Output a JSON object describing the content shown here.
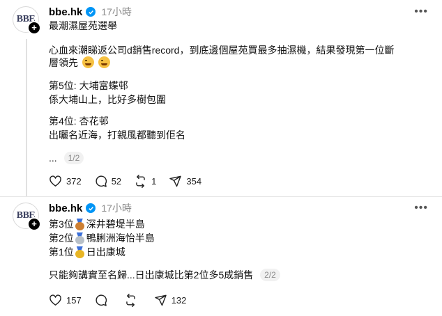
{
  "posts": [
    {
      "avatar_text": "BBE",
      "username": "bbe.hk",
      "time": "17小時",
      "title": "最潮濕屋苑選舉",
      "body_line1": "心血來潮睇返公司d銷售record，到底邊個屋苑買最多抽濕機，結果發現第一位斷",
      "body_line2": "層領先",
      "rank5_title": "第5位: 大埔富蝶邨",
      "rank5_desc": "係大埔山上，比好多樹包圍",
      "rank4_title": "第4位: 杏花邨",
      "rank4_desc": "出曬名近海，打親風都聽到佢名",
      "ellipsis": "...",
      "page_counter": "1/2",
      "likes": "372",
      "comments": "52",
      "reposts": "1",
      "shares": "354"
    },
    {
      "avatar_text": "BBE",
      "username": "bbe.hk",
      "time": "17小時",
      "rank3_label": "第3位",
      "rank3_name": "深井碧堤半島",
      "rank2_label": "第2位",
      "rank2_name": "鴨脷洲海怡半島",
      "rank1_label": "第1位",
      "rank1_name": "日出康城",
      "summary": "只能夠講實至名歸...日出康城比第2位多5成銷售",
      "page_counter": "2/2",
      "likes": "157",
      "shares": "132"
    }
  ],
  "colors": {
    "verified": "#0095f6",
    "bronze": "#cd7f32",
    "silver": "#b8c0c8",
    "gold": "#e8b525"
  },
  "icons": [
    "heart-icon",
    "comment-icon",
    "repost-icon",
    "share-icon",
    "more-icon",
    "verified-icon",
    "plus-icon",
    "medal-icon"
  ]
}
